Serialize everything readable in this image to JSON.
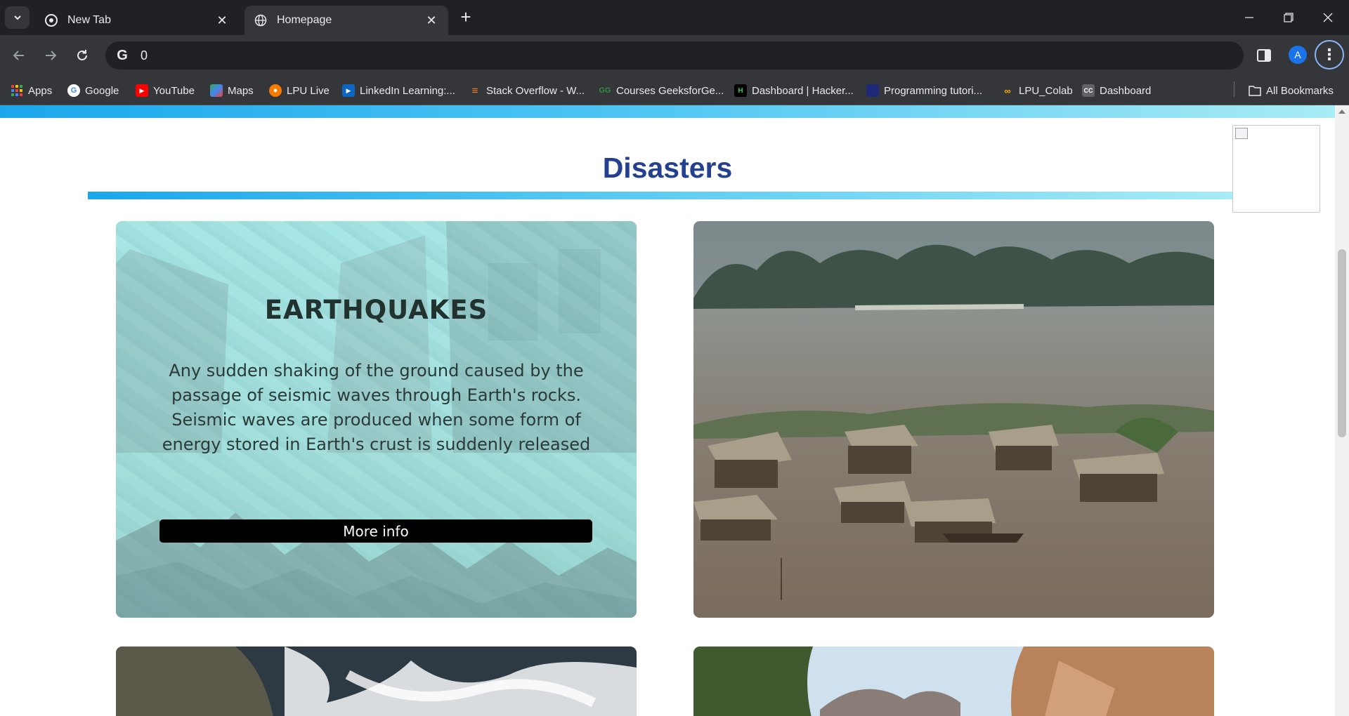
{
  "browser": {
    "tabs": [
      {
        "title": "New Tab",
        "active": false
      },
      {
        "title": "Homepage",
        "active": true
      }
    ],
    "address": "0",
    "profile_initial": "A",
    "bookmarks": [
      {
        "label": "Apps",
        "icon": "apps-grid-icon",
        "color": "#ea4335"
      },
      {
        "label": "Google",
        "icon": "google-icon",
        "color": "#4285f4"
      },
      {
        "label": "YouTube",
        "icon": "youtube-icon",
        "color": "#ff0000"
      },
      {
        "label": "Maps",
        "icon": "maps-icon",
        "color": "#34a853"
      },
      {
        "label": "LPU Live",
        "icon": "lpu-live-icon",
        "color": "#f57c00"
      },
      {
        "label": "LinkedIn Learning:...",
        "icon": "linkedin-learning-icon",
        "color": "#0a66c2"
      },
      {
        "label": "Stack Overflow - W...",
        "icon": "stack-overflow-icon",
        "color": "#f48024"
      },
      {
        "label": "Courses GeeksforGe...",
        "icon": "geeksforgeeks-icon",
        "color": "#2f8d46"
      },
      {
        "label": "Dashboard | Hacker...",
        "icon": "hackerrank-icon",
        "color": "#000000"
      },
      {
        "label": "Programming tutori...",
        "icon": "programming-icon",
        "color": "#1e2a78"
      },
      {
        "label": "LPU_Colab",
        "icon": "colab-icon",
        "color": "#f9ab00"
      },
      {
        "label": "Dashboard",
        "icon": "cc-icon",
        "color": "#5f6368"
      }
    ],
    "all_bookmarks": "All Bookmarks"
  },
  "page": {
    "section_title": "Disasters",
    "cards": [
      {
        "title": "EARTHQUAKES",
        "description": "Any sudden shaking of the ground caused by the passage of seismic waves through Earth's rocks. Seismic waves are produced when some form of energy stored in Earth's crust is suddenly released",
        "button": "More info"
      }
    ]
  },
  "colors": {
    "title": "#24418f",
    "accent_gradient_start": "#1aa7ec",
    "accent_gradient_end": "#a8ecf5",
    "card_overlay": "#a5ecec"
  }
}
